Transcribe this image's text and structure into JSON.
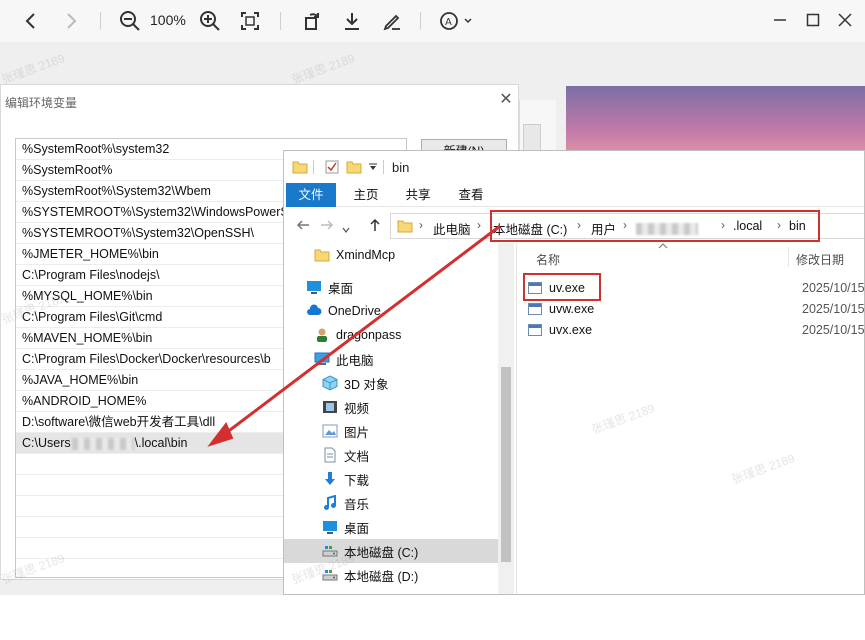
{
  "viewer": {
    "zoom_level": "100%"
  },
  "env_dialog": {
    "title": "编辑环境变量",
    "close_glyph": "✕",
    "new_button": "新建(N)",
    "rows": [
      "%SystemRoot%\\system32",
      "%SystemRoot%",
      "%SystemRoot%\\System32\\Wbem",
      "%SYSTEMROOT%\\System32\\WindowsPowerS",
      "%SYSTEMROOT%\\System32\\OpenSSH\\",
      "%JMETER_HOME%\\bin",
      "C:\\Program Files\\nodejs\\",
      "%MYSQL_HOME%\\bin",
      "C:\\Program Files\\Git\\cmd",
      "%MAVEN_HOME%\\bin",
      "C:\\Program Files\\Docker\\Docker\\resources\\b",
      "%JAVA_HOME%\\bin",
      "%ANDROID_HOME%",
      "D:\\software\\微信web开发者工具\\dll"
    ],
    "last_row_prefix": "C:\\Users",
    "last_row_suffix": "\\.local\\bin"
  },
  "explorer": {
    "title": "bin",
    "tabs": [
      "文件",
      "主页",
      "共享",
      "查看"
    ],
    "breadcrumbs": {
      "this_pc": "此电脑",
      "drive": "本地磁盘 (C:)",
      "users": "用户",
      "local": ".local",
      "bin": "bin"
    },
    "nav_items": [
      {
        "label": "XmindMcp",
        "icon": "folder-icon"
      },
      {
        "label": "桌面",
        "icon": "desktop-icon"
      },
      {
        "label": "OneDrive",
        "icon": "cloud-icon"
      },
      {
        "label": "dragonpass",
        "icon": "user-icon"
      },
      {
        "label": "此电脑",
        "icon": "computer-icon"
      },
      {
        "label": "3D 对象",
        "icon": "cube-icon"
      },
      {
        "label": "视频",
        "icon": "video-icon"
      },
      {
        "label": "图片",
        "icon": "picture-icon"
      },
      {
        "label": "文档",
        "icon": "document-icon"
      },
      {
        "label": "下载",
        "icon": "download-icon"
      },
      {
        "label": "音乐",
        "icon": "music-icon"
      },
      {
        "label": "桌面",
        "icon": "desktop-icon"
      },
      {
        "label": "本地磁盘 (C:)",
        "icon": "drive-icon"
      },
      {
        "label": "本地磁盘 (D:)",
        "icon": "drive-icon"
      }
    ],
    "columns": {
      "name": "名称",
      "modified": "修改日期"
    },
    "files": [
      {
        "name": "uv.exe",
        "date": "2025/10/15"
      },
      {
        "name": "uvw.exe",
        "date": "2025/10/15"
      },
      {
        "name": "uvx.exe",
        "date": "2025/10/15"
      }
    ]
  },
  "watermark": "张瑾思 2189"
}
